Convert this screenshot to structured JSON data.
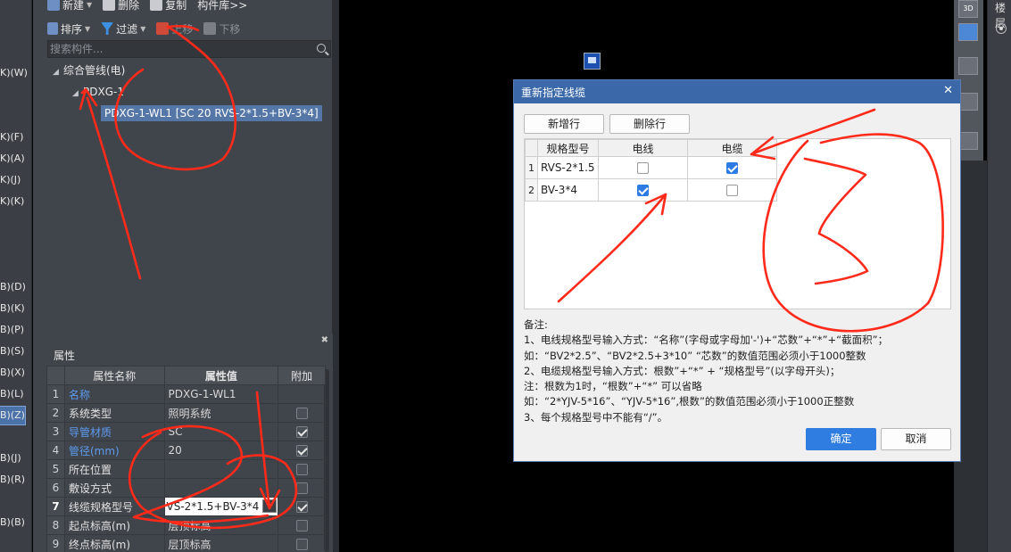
{
  "left_strip": {
    "items": [
      "K)(W)",
      "K)(F)",
      "K)(A)",
      "K)(J)",
      "K)(K)",
      "B)(D)",
      "B)(K)",
      "B)(P)",
      "B)(S)",
      "B)(X)",
      "B)(L)",
      "B)(Z)",
      "B)(J)",
      "B)(R)",
      "B)(B)"
    ],
    "selected_index": 11
  },
  "component_panel": {
    "toolbar_top": {
      "new": "新建",
      "delete": "删除",
      "copy": "复制",
      "library": "构件库>>"
    },
    "toolbar": {
      "sort": "排序",
      "filter": "过滤",
      "move_up": "上移",
      "move_down": "下移"
    },
    "search_placeholder": "搜索构件...",
    "tree": {
      "root": "综合管线(电)",
      "child": "PDXG-1",
      "leaf": "PDXG-1-WL1 [SC 20 RVS-2*1.5+BV-3*4]"
    }
  },
  "properties": {
    "title": "属性",
    "columns": {
      "name": "属性名称",
      "value": "属性值",
      "add": "附加"
    },
    "rows": [
      {
        "idx": "1",
        "name": "名称",
        "value": "PDXG-1-WL1",
        "blue": true,
        "check": "none"
      },
      {
        "idx": "2",
        "name": "系统类型",
        "value": "照明系统",
        "blue": false,
        "check": "off"
      },
      {
        "idx": "3",
        "name": "导管材质",
        "value": "SC",
        "blue": true,
        "check": "on"
      },
      {
        "idx": "4",
        "name": "管径(mm)",
        "value": "20",
        "blue": true,
        "check": "on"
      },
      {
        "idx": "5",
        "name": "所在位置",
        "value": "",
        "blue": false,
        "check": "off"
      },
      {
        "idx": "6",
        "name": "敷设方式",
        "value": "",
        "blue": false,
        "check": "off"
      },
      {
        "idx": "7",
        "name": "线缆规格型号",
        "value": "VS-2*1.5+BV-3*4",
        "blue": false,
        "check": "on"
      },
      {
        "idx": "8",
        "name": "起点标高(m)",
        "value": "层顶标高",
        "blue": false,
        "check": "off"
      },
      {
        "idx": "9",
        "name": "终点标高(m)",
        "value": "层顶标高",
        "blue": false,
        "check": "off"
      }
    ],
    "edit_button": "···"
  },
  "right_panel": {
    "label": "楼层",
    "view_badge": "3D"
  },
  "dialog": {
    "title": "重新指定线缆",
    "add_row": "新增行",
    "delete_row": "删除行",
    "columns": {
      "spec": "规格型号",
      "wire": "电线",
      "cable": "电缆"
    },
    "rows": [
      {
        "idx": "1",
        "spec": "RVS-2*1.5",
        "wire": false,
        "cable": true
      },
      {
        "idx": "2",
        "spec": "BV-3*4",
        "wire": true,
        "cable": false
      }
    ],
    "notes": [
      "备注:",
      "1、电线规格型号输入方式：“名称”(字母或字母加'-')+“芯数”+“*”+“截面积”；",
      "如：“BV2*2.5”、“BV2*2.5+3*10” “芯数”的数值范围必须小于1000整数",
      "2、电缆规格型号输入方式：根数”+“*” + “规格型号”(以字母开头)；",
      "注：根数为1时，“根数”+“*” 可以省略",
      "如：“2*YJV-5*16”、“YJV-5*16”,根数”的数值范围必须小于1000正整数",
      "3、每个规格型号中不能有“/”。"
    ],
    "ok": "确定",
    "cancel": "取消"
  },
  "colors": {
    "accent": "#2f7de1",
    "titlebar": "#3a68a8",
    "annotation": "#ff2a1a"
  }
}
